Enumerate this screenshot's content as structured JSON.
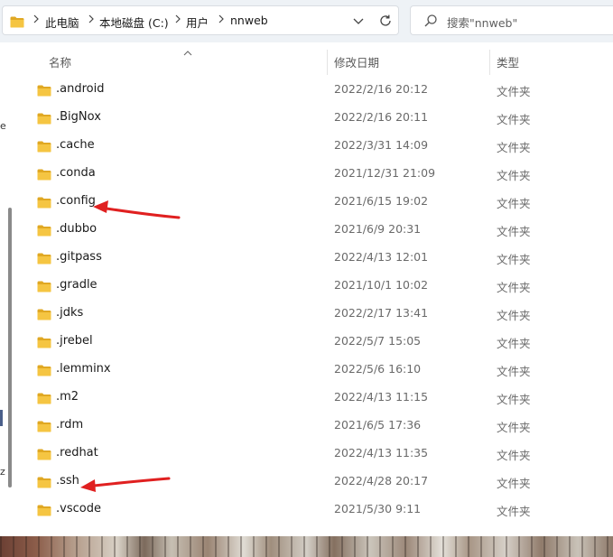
{
  "breadcrumb": {
    "items": [
      "此电脑",
      "本地磁盘 (C:)",
      "用户",
      "nnweb"
    ]
  },
  "search": {
    "placeholder": "搜索\"nnweb\""
  },
  "columns": {
    "name": "名称",
    "modified": "修改日期",
    "type": "类型"
  },
  "files": [
    {
      "name": ".android",
      "modified": "2022/2/16 20:12",
      "type": "文件夹"
    },
    {
      "name": ".BigNox",
      "modified": "2022/2/16 20:11",
      "type": "文件夹"
    },
    {
      "name": ".cache",
      "modified": "2022/3/31 14:09",
      "type": "文件夹"
    },
    {
      "name": ".conda",
      "modified": "2021/12/31 21:09",
      "type": "文件夹"
    },
    {
      "name": ".config",
      "modified": "2021/6/15 19:02",
      "type": "文件夹"
    },
    {
      "name": ".dubbo",
      "modified": "2021/6/9 20:31",
      "type": "文件夹"
    },
    {
      "name": ".gitpass",
      "modified": "2022/4/13 12:01",
      "type": "文件夹"
    },
    {
      "name": ".gradle",
      "modified": "2021/10/1 10:02",
      "type": "文件夹"
    },
    {
      "name": ".jdks",
      "modified": "2022/2/17 13:41",
      "type": "文件夹"
    },
    {
      "name": ".jrebel",
      "modified": "2022/5/7 15:05",
      "type": "文件夹"
    },
    {
      "name": ".lemminx",
      "modified": "2022/5/6 16:10",
      "type": "文件夹"
    },
    {
      "name": ".m2",
      "modified": "2022/4/13 11:15",
      "type": "文件夹"
    },
    {
      "name": ".rdm",
      "modified": "2021/6/5 17:36",
      "type": "文件夹"
    },
    {
      "name": ".redhat",
      "modified": "2022/4/13 11:35",
      "type": "文件夹"
    },
    {
      "name": ".ssh",
      "modified": "2022/4/28 20:17",
      "type": "文件夹"
    },
    {
      "name": ".vscode",
      "modified": "2021/5/30 9:11",
      "type": "文件夹"
    }
  ],
  "left_edge_glyphs": [
    "e",
    "z"
  ],
  "annotations": {
    "arrow_color": "#e02020",
    "arrow_targets": [
      ".config",
      ".ssh"
    ]
  },
  "colors": {
    "folder_yellow": "#f5c542",
    "folder_dark": "#e0a823",
    "topbar_bg": "#eef2f6"
  },
  "icons": {
    "address_folder": "folder-icon",
    "separator": "chevron-right-icon",
    "dropdown": "chevron-down-icon",
    "refresh": "refresh-icon",
    "search": "search-icon",
    "sort": "sort-up-icon",
    "row": "folder-icon"
  }
}
